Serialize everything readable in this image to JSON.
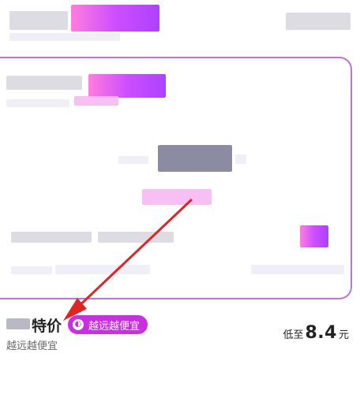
{
  "deal": {
    "title": "特价",
    "badge_label": "越远越便宜",
    "subtitle": "越远越便宜",
    "price_prefix": "低至",
    "price_value": "8.4",
    "price_unit": "元"
  },
  "colors": {
    "accent_purple": "#c92ee3",
    "card_border": "#b774e2",
    "arrow_red": "#e02424"
  },
  "icons": {
    "badge_icon": "crescent-badge-icon",
    "arrow": "annotation-arrow"
  }
}
